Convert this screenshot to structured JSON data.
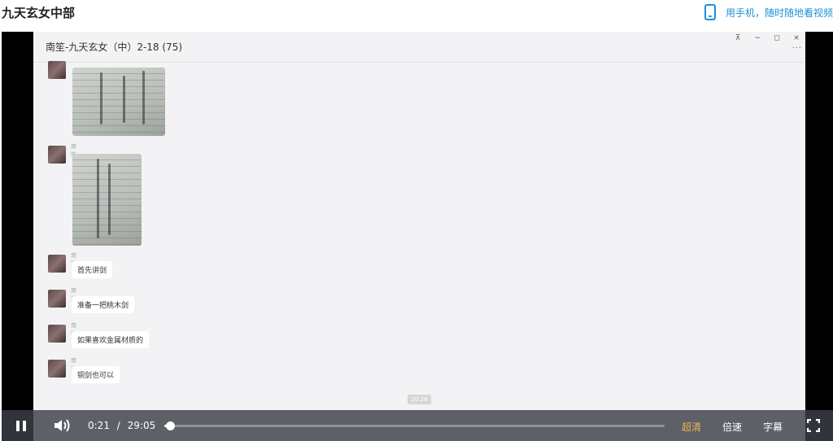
{
  "page": {
    "title": "九天玄女中部",
    "mobile_link": "用手机，随时随地看视频"
  },
  "chat": {
    "title": "南笙-九天玄女（中）2-18 (75)",
    "window_controls": [
      "⊼",
      "−",
      "◻",
      "×"
    ],
    "more": "···",
    "messages": [
      {
        "sender": "南笙",
        "text": "首先讲剑"
      },
      {
        "sender": "南笙",
        "text": "准备一把桃木剑"
      },
      {
        "sender": "南笙",
        "text": "如果喜欢金属材质的"
      },
      {
        "sender": "南笙",
        "text": "铜剑也可以"
      }
    ],
    "image_sender": "南笙",
    "timestamp": "20:28"
  },
  "player": {
    "current_time": "0:21",
    "separator": "/",
    "duration": "29:05",
    "progress_fraction": 0.012,
    "quality": "超清",
    "speed": "倍速",
    "subtitle": "字幕",
    "accent_color": "#e8b74f"
  },
  "icons": {
    "phone": "phone-icon",
    "pause": "pause-icon",
    "volume": "volume-icon",
    "fullscreen": "fullscreen-icon"
  }
}
